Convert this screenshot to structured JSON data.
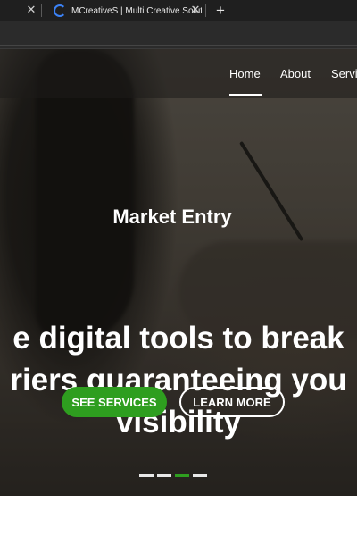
{
  "browser": {
    "tabs": [
      {
        "title": ""
      },
      {
        "title": "MCreativeS | Multi Creative Solutions"
      }
    ],
    "new_tab": "+"
  },
  "nav": {
    "items": [
      "Home",
      "About",
      "Servi"
    ]
  },
  "hero": {
    "subtitle": "Market Entry",
    "headline_line1": "e digital tools to break",
    "headline_line2": "riers guaranteeing you",
    "headline_line3": "visibility",
    "primary_button": "SEE SERVICES",
    "secondary_button": "LEARN MORE",
    "slides_total": 4,
    "slide_active_index": 2,
    "accent_color": "#2e9e1f"
  }
}
